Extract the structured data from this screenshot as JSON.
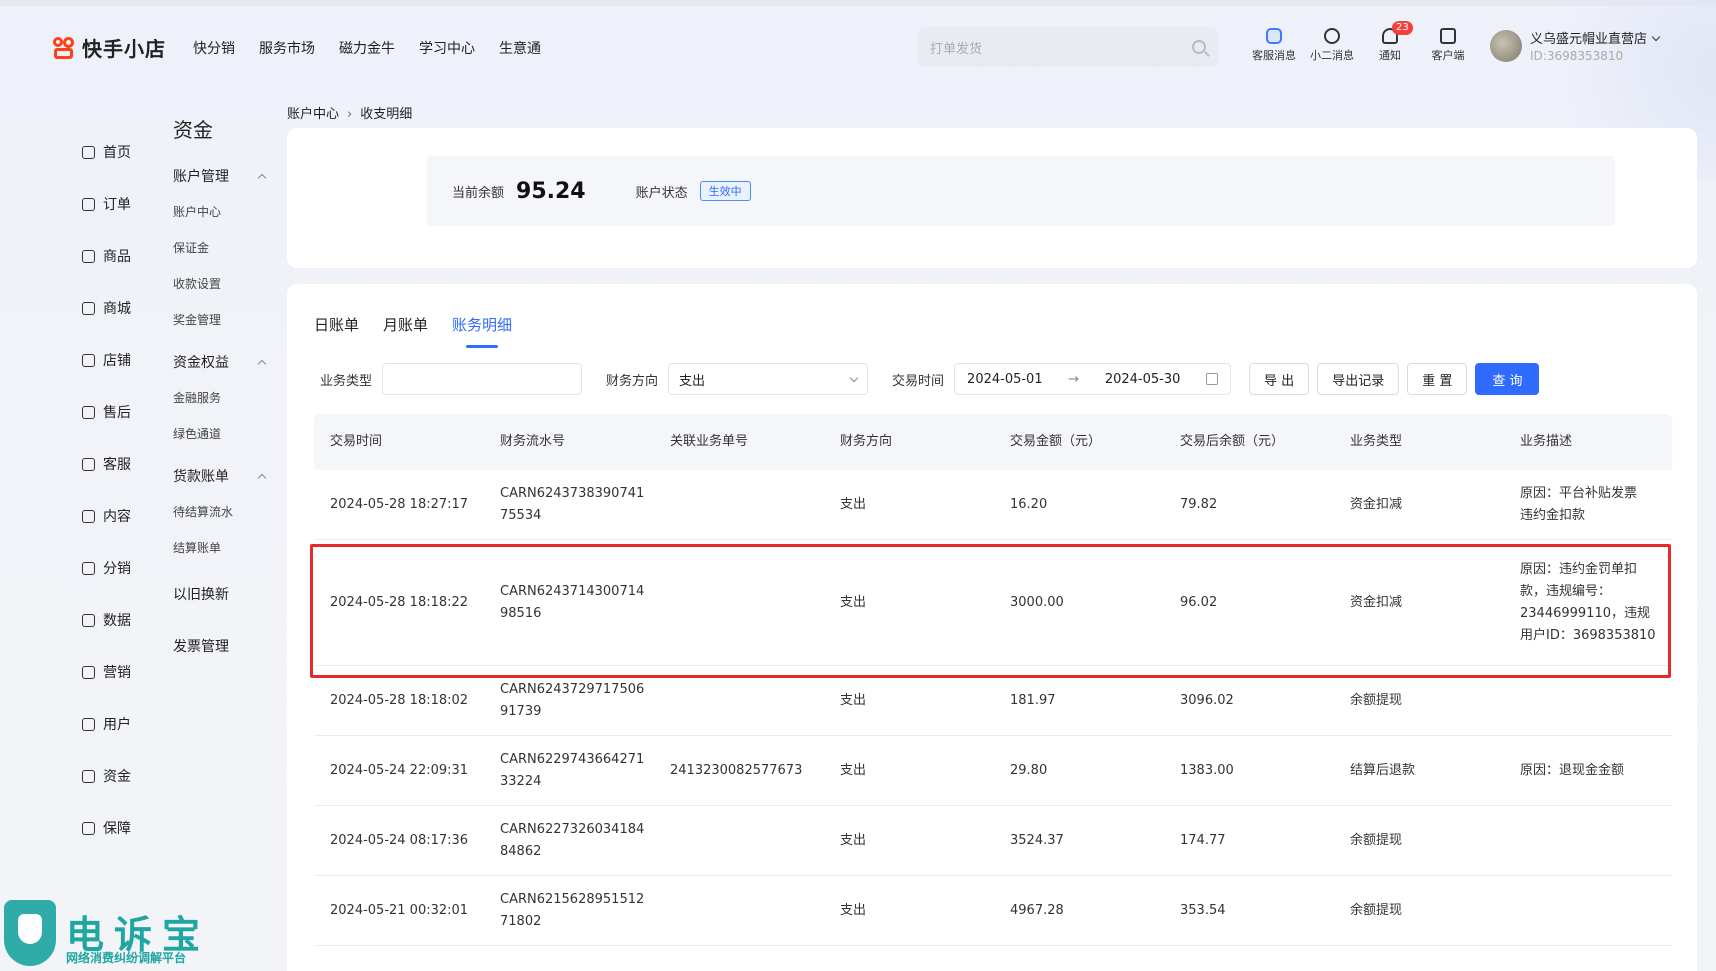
{
  "brand": {
    "logo_text": "快手小店",
    "accent": "#2f6bff",
    "logo_color": "#fe3f17"
  },
  "topnav": [
    "快分销",
    "服务市场",
    "磁力金牛",
    "学习中心",
    "生意通"
  ],
  "search": {
    "placeholder": "打单发货"
  },
  "top_icons": [
    {
      "label": "客服消息",
      "icon": "robot-icon"
    },
    {
      "label": "小二消息",
      "icon": "chat-icon"
    },
    {
      "label": "通知",
      "icon": "bell-icon",
      "badge": "23"
    },
    {
      "label": "客户端",
      "icon": "desktop-icon"
    }
  ],
  "user": {
    "name": "义乌盛元帽业直营店",
    "id": "ID:3698353810"
  },
  "primary_nav": [
    "首页",
    "订单",
    "商品",
    "商城",
    "店铺",
    "售后",
    "客服",
    "内容",
    "分销",
    "数据",
    "营销",
    "用户",
    "资金",
    "保障"
  ],
  "secondary_nav": {
    "title": "资金",
    "groups": [
      {
        "label": "账户管理",
        "items": [
          "账户中心",
          "保证金",
          "收款设置",
          "奖金管理"
        ]
      },
      {
        "label": "资金权益",
        "items": [
          "金融服务",
          "绿色通道"
        ]
      },
      {
        "label": "货款账单",
        "items": [
          "待结算流水",
          "结算账单"
        ]
      },
      {
        "label": "以旧换新",
        "items": []
      },
      {
        "label": "发票管理",
        "items": []
      }
    ]
  },
  "breadcrumb": {
    "parent": "账户中心",
    "sep": "›",
    "current": "收支明细"
  },
  "balance": {
    "label": "当前余额",
    "value": "95.24",
    "status_label": "账户状态",
    "status": "生效中"
  },
  "tabs": [
    "日账单",
    "月账单",
    "账务明细"
  ],
  "filters": {
    "biz_type_label": "业务类型",
    "direction_label": "财务方向",
    "direction_value": "支出",
    "time_label": "交易时间",
    "date_from": "2024-05-01",
    "arrow": "→",
    "date_to": "2024-05-30",
    "buttons": {
      "export": "导 出",
      "export_log": "导出记录",
      "reset": "重 置",
      "query": "查 询"
    }
  },
  "table": {
    "headers": [
      "交易时间",
      "财务流水号",
      "关联业务单号",
      "财务方向",
      "交易金额（元）",
      "交易后余额（元）",
      "业务类型",
      "业务描述"
    ],
    "rows": [
      {
        "time": "2024-05-28 18:27:17",
        "serial": [
          "CARN6243738390741",
          "75534"
        ],
        "ref": "",
        "dir": "支出",
        "amount": "16.20",
        "after": "79.82",
        "type": "资金扣减",
        "desc": [
          "原因：平台补贴发票",
          "违约金扣款"
        ]
      },
      {
        "time": "2024-05-28 18:18:22",
        "serial": [
          "CARN6243714300714",
          "98516"
        ],
        "ref": "",
        "dir": "支出",
        "amount": "3000.00",
        "after": "96.02",
        "type": "资金扣减",
        "desc": [
          "原因：违约金罚单扣",
          "款，违规编号：",
          "23446999110，违规",
          "用户ID：3698353810"
        ]
      },
      {
        "time": "2024-05-28 18:18:02",
        "serial": [
          "CARN6243729717506",
          "91739"
        ],
        "ref": "",
        "dir": "支出",
        "amount": "181.97",
        "after": "3096.02",
        "type": "余额提现",
        "desc": []
      },
      {
        "time": "2024-05-24 22:09:31",
        "serial": [
          "CARN6229743664271",
          "33224"
        ],
        "ref": "2413230082577673",
        "dir": "支出",
        "amount": "29.80",
        "after": "1383.00",
        "type": "结算后退款",
        "desc": [
          "原因：退现金金额"
        ]
      },
      {
        "time": "2024-05-24 08:17:36",
        "serial": [
          "CARN6227326034184",
          "84862"
        ],
        "ref": "",
        "dir": "支出",
        "amount": "3524.37",
        "after": "174.77",
        "type": "余额提现",
        "desc": []
      },
      {
        "time": "2024-05-21 00:32:01",
        "serial": [
          "CARN6215628951512",
          "71802"
        ],
        "ref": "",
        "dir": "支出",
        "amount": "4967.28",
        "after": "353.54",
        "type": "余额提现",
        "desc": []
      }
    ]
  },
  "watermark": {
    "title": "电诉宝",
    "subtitle": "网络消费纠纷调解平台",
    "color": "#1fa6a1"
  }
}
